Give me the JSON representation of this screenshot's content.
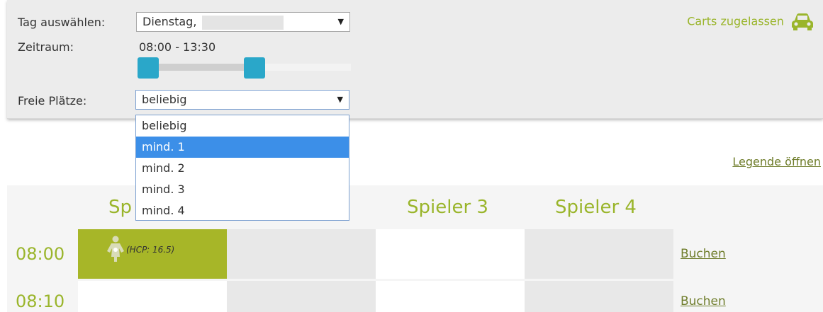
{
  "filters": {
    "day_label": "Tag auswählen:",
    "day_value": "Dienstag,",
    "period_label": "Zeitraum:",
    "period_value": "08:00 - 13:30",
    "slots_label": "Freie Plätze:",
    "slots_value": "beliebig",
    "carts_label": "Carts zugelassen",
    "carts_icon": "car-icon",
    "slider": {
      "min_fraction": 0.0,
      "max_fraction": 0.5
    }
  },
  "dropdown": {
    "options": [
      "beliebig",
      "mind. 1",
      "mind. 2",
      "mind. 3",
      "mind. 4"
    ],
    "highlighted_index": 1
  },
  "legend_link": "Legende öffnen",
  "grid": {
    "columns": [
      "Sp",
      "Spieler 3",
      "Spieler 4"
    ],
    "rows": [
      {
        "time": "08:00",
        "player1_hcp": "(HCP: 16.5)",
        "book": "Buchen"
      },
      {
        "time": "08:10",
        "book": "Buchen"
      }
    ]
  },
  "colors": {
    "accent": "#9ab52b",
    "booked": "#a7b628",
    "slider_handle": "#2aa7c9",
    "highlight": "#3c8fe8"
  }
}
